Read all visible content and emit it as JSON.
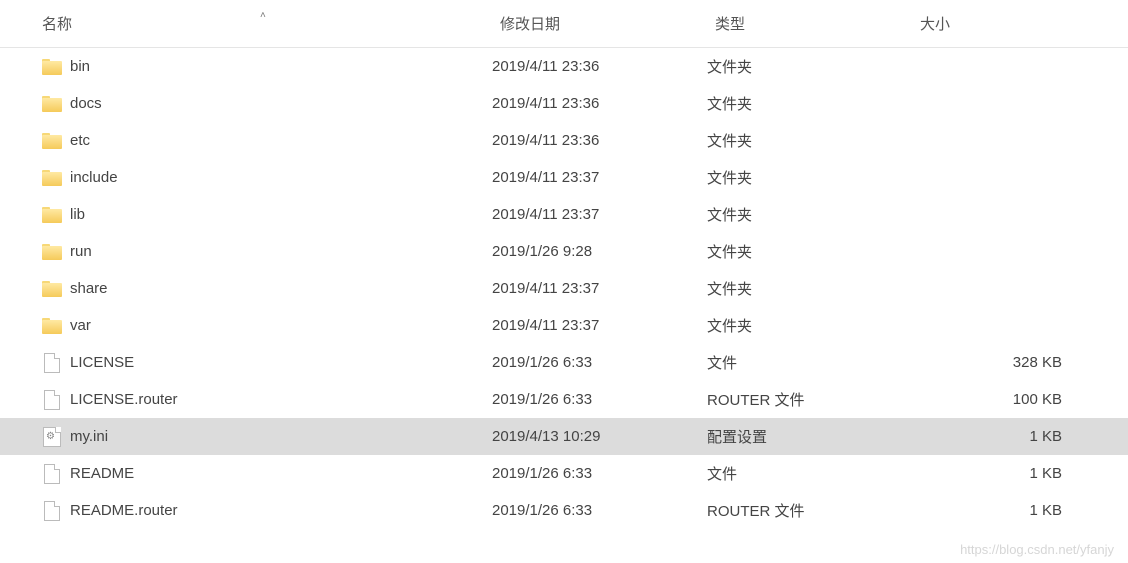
{
  "columns": {
    "name": "名称",
    "date": "修改日期",
    "type": "类型",
    "size": "大小"
  },
  "sort_indicator": "˄",
  "files": [
    {
      "icon": "folder",
      "name": "bin",
      "date": "2019/4/11 23:36",
      "type": "文件夹",
      "size": "",
      "selected": false
    },
    {
      "icon": "folder",
      "name": "docs",
      "date": "2019/4/11 23:36",
      "type": "文件夹",
      "size": "",
      "selected": false
    },
    {
      "icon": "folder",
      "name": "etc",
      "date": "2019/4/11 23:36",
      "type": "文件夹",
      "size": "",
      "selected": false
    },
    {
      "icon": "folder",
      "name": "include",
      "date": "2019/4/11 23:37",
      "type": "文件夹",
      "size": "",
      "selected": false
    },
    {
      "icon": "folder",
      "name": "lib",
      "date": "2019/4/11 23:37",
      "type": "文件夹",
      "size": "",
      "selected": false
    },
    {
      "icon": "folder",
      "name": "run",
      "date": "2019/1/26 9:28",
      "type": "文件夹",
      "size": "",
      "selected": false
    },
    {
      "icon": "folder",
      "name": "share",
      "date": "2019/4/11 23:37",
      "type": "文件夹",
      "size": "",
      "selected": false
    },
    {
      "icon": "folder",
      "name": "var",
      "date": "2019/4/11 23:37",
      "type": "文件夹",
      "size": "",
      "selected": false
    },
    {
      "icon": "file",
      "name": "LICENSE",
      "date": "2019/1/26 6:33",
      "type": "文件",
      "size": "328 KB",
      "selected": false
    },
    {
      "icon": "file",
      "name": "LICENSE.router",
      "date": "2019/1/26 6:33",
      "type": "ROUTER 文件",
      "size": "100 KB",
      "selected": false
    },
    {
      "icon": "ini",
      "name": "my.ini",
      "date": "2019/4/13 10:29",
      "type": "配置设置",
      "size": "1 KB",
      "selected": true
    },
    {
      "icon": "file",
      "name": "README",
      "date": "2019/1/26 6:33",
      "type": "文件",
      "size": "1 KB",
      "selected": false
    },
    {
      "icon": "file",
      "name": "README.router",
      "date": "2019/1/26 6:33",
      "type": "ROUTER 文件",
      "size": "1 KB",
      "selected": false
    }
  ],
  "watermark": "https://blog.csdn.net/yfanjy"
}
